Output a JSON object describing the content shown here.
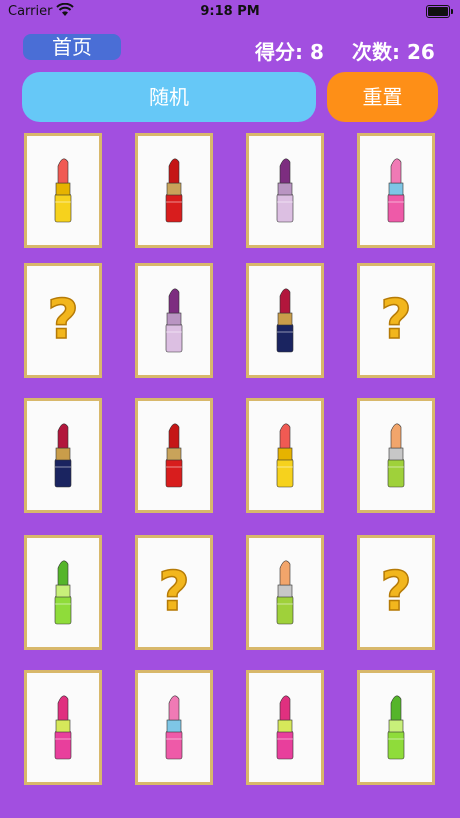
{
  "status": {
    "carrier": "Carrier",
    "time": "9:18 PM"
  },
  "header": {
    "home_label": "首页",
    "score_text": "得分: 8",
    "moves_text": "次数: 26"
  },
  "actions": {
    "random_label": "随机",
    "reset_label": "重置"
  },
  "colors": {
    "background": "#a24fe0",
    "random": "#66c8f7",
    "reset": "#fe8f17",
    "home": "#4a6ed6"
  },
  "cards": [
    {
      "icon": "lipstick-coral-icon",
      "body": "#f6d21d",
      "tube": "#e6b300",
      "bullet": "#f05a53"
    },
    {
      "icon": "lipstick-red-icon",
      "body": "#d81d1d",
      "tube": "#c9a35a",
      "bullet": "#c51616"
    },
    {
      "icon": "lipstick-lilac-icon",
      "body": "#dcbfe2",
      "tube": "#b995c2",
      "bullet": "#7d2d80"
    },
    {
      "icon": "lipstick-pink-icon",
      "body": "#ee5aa8",
      "tube": "#7ec6e6",
      "bullet": "#f07ab5"
    },
    {
      "icon": "question-mark-icon"
    },
    {
      "icon": "lipstick-lilac-icon",
      "body": "#dcbfe2",
      "tube": "#b995c2",
      "bullet": "#7d2d80"
    },
    {
      "icon": "lipstick-navy-icon",
      "body": "#1a2460",
      "tube": "#c99d4a",
      "bullet": "#b2163c"
    },
    {
      "icon": "question-mark-icon"
    },
    {
      "icon": "lipstick-navy-icon",
      "body": "#1a2460",
      "tube": "#c99d4a",
      "bullet": "#b2163c"
    },
    {
      "icon": "lipstick-red-icon",
      "body": "#d81d1d",
      "tube": "#c9a35a",
      "bullet": "#c51616"
    },
    {
      "icon": "lipstick-coral-icon",
      "body": "#f6d21d",
      "tube": "#e6b300",
      "bullet": "#f05a53"
    },
    {
      "icon": "lipstick-peach-icon",
      "body": "#9fd13a",
      "tube": "#c7c7c7",
      "bullet": "#f2a56b"
    },
    {
      "icon": "lipstick-green-icon",
      "body": "#8fdc3a",
      "tube": "#c8f07a",
      "bullet": "#55b52a"
    },
    {
      "icon": "question-mark-icon"
    },
    {
      "icon": "lipstick-peach-icon",
      "body": "#9fd13a",
      "tube": "#c7c7c7",
      "bullet": "#f2a56b"
    },
    {
      "icon": "question-mark-icon"
    },
    {
      "icon": "lipstick-magenta-icon",
      "body": "#e83f9c",
      "tube": "#d6e85a",
      "bullet": "#e0307f"
    },
    {
      "icon": "lipstick-pink-icon",
      "body": "#ee5aa8",
      "tube": "#7ec6e6",
      "bullet": "#f07ab5"
    },
    {
      "icon": "lipstick-magenta-icon",
      "body": "#e83f9c",
      "tube": "#d6e85a",
      "bullet": "#e0307f"
    },
    {
      "icon": "lipstick-green-icon",
      "body": "#8fdc3a",
      "tube": "#c8f07a",
      "bullet": "#55b52a"
    }
  ]
}
